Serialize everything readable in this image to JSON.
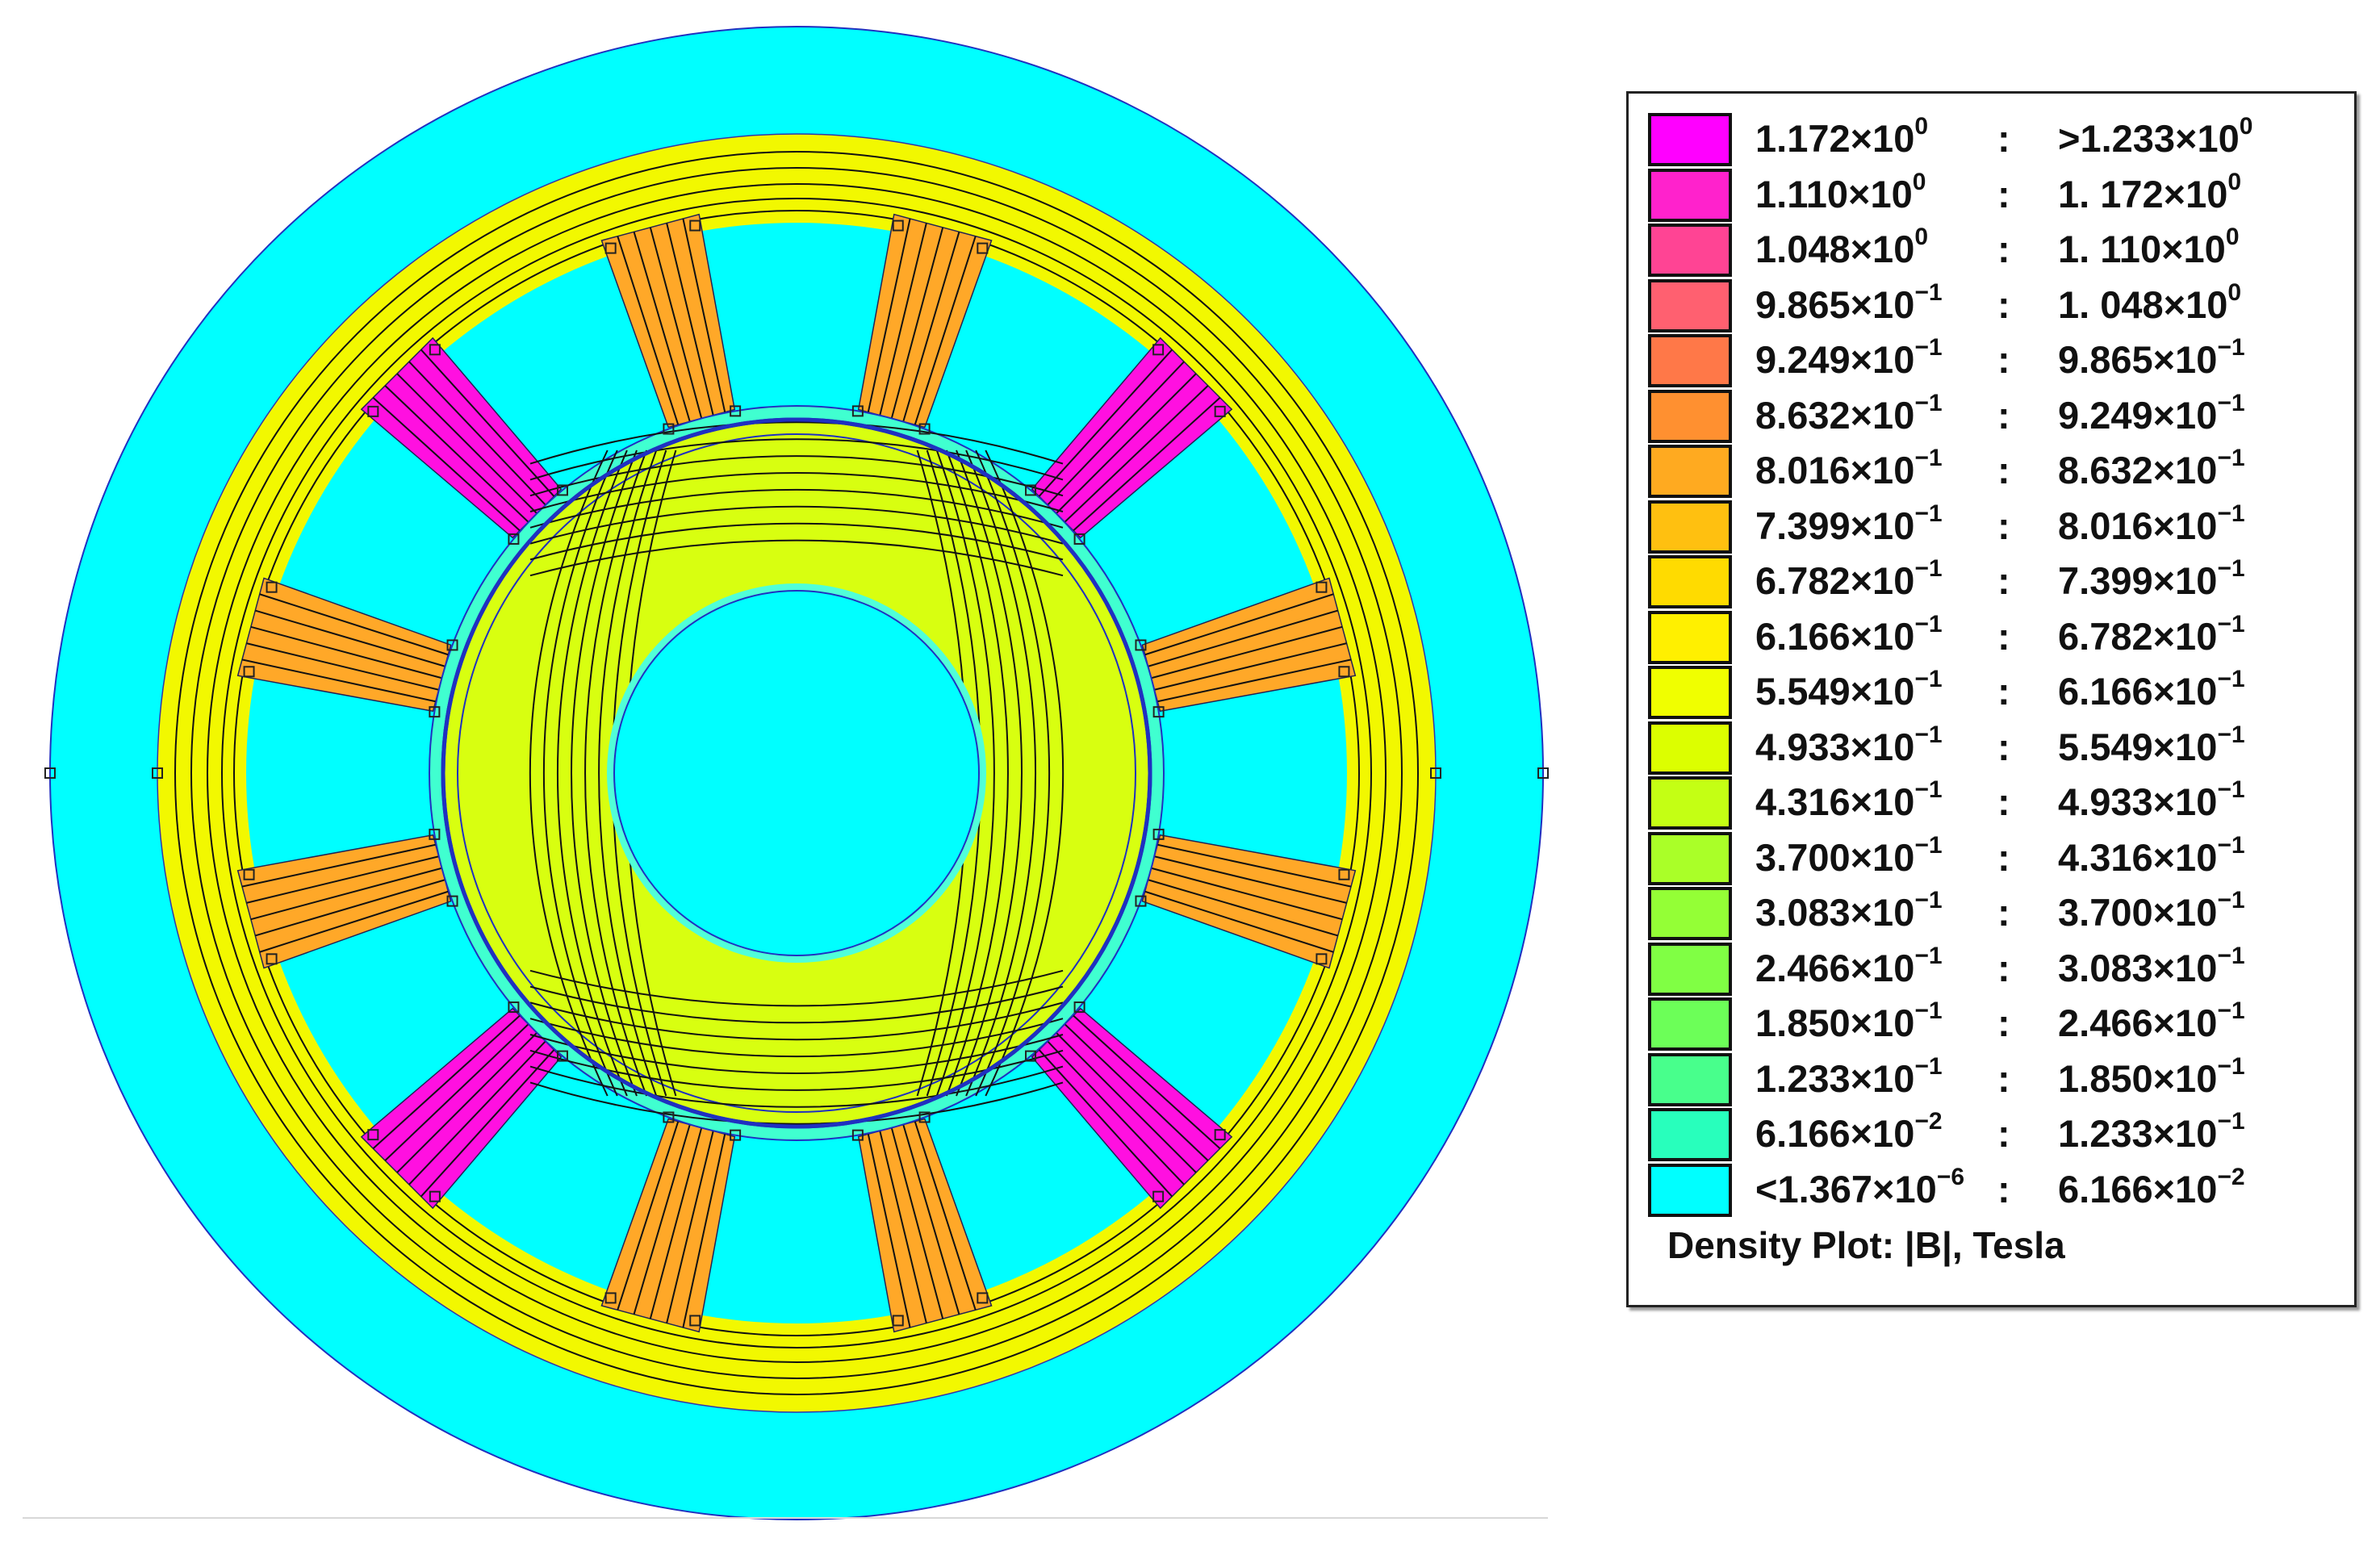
{
  "legend": {
    "title": "Density Plot: |B|, Tesla",
    "rows": [
      {
        "low": "1.172×10",
        "low_exp": "0",
        "high": ">1.233×10",
        "high_exp": "0",
        "color": "#ff00ff"
      },
      {
        "low": "1.110×10",
        "low_exp": "0",
        "high": "1. 172×10",
        "high_exp": "0",
        "color": "#ff22cc"
      },
      {
        "low": "1.048×10",
        "low_exp": "0",
        "high": "1. 110×10",
        "high_exp": "0",
        "color": "#ff4494"
      },
      {
        "low": "9.865×10",
        "low_exp": "−1",
        "high": "1. 048×10",
        "high_exp": "0",
        "color": "#ff6070"
      },
      {
        "low": "9.249×10",
        "low_exp": "−1",
        "high": "9.865×10",
        "high_exp": "−1",
        "color": "#ff7848"
      },
      {
        "low": "8.632×10",
        "low_exp": "−1",
        "high": "9.249×10",
        "high_exp": "−1",
        "color": "#ff9030"
      },
      {
        "low": "8.016×10",
        "low_exp": "−1",
        "high": "8.632×10",
        "high_exp": "−1",
        "color": "#ffaa20"
      },
      {
        "low": "7.399×10",
        "low_exp": "−1",
        "high": "8.016×10",
        "high_exp": "−1",
        "color": "#ffc010"
      },
      {
        "low": "6.782×10",
        "low_exp": "−1",
        "high": "7.399×10",
        "high_exp": "−1",
        "color": "#ffdb00"
      },
      {
        "low": "6.166×10",
        "low_exp": "−1",
        "high": "6.782×10",
        "high_exp": "−1",
        "color": "#fff000"
      },
      {
        "low": "5.549×10",
        "low_exp": "−1",
        "high": "6.166×10",
        "high_exp": "−1",
        "color": "#f0ff00"
      },
      {
        "low": "4.933×10",
        "low_exp": "−1",
        "high": "5.549×10",
        "high_exp": "−1",
        "color": "#dcff00"
      },
      {
        "low": "4.316×10",
        "low_exp": "−1",
        "high": "4.933×10",
        "high_exp": "−1",
        "color": "#c4ff14"
      },
      {
        "low": "3.700×10",
        "low_exp": "−1",
        "high": "4.316×10",
        "high_exp": "−1",
        "color": "#aaff28"
      },
      {
        "low": "3.083×10",
        "low_exp": "−1",
        "high": "3.700×10",
        "high_exp": "−1",
        "color": "#94ff36"
      },
      {
        "low": "2.466×10",
        "low_exp": "−1",
        "high": "3.083×10",
        "high_exp": "−1",
        "color": "#80ff44"
      },
      {
        "low": "1.850×10",
        "low_exp": "−1",
        "high": "2.466×10",
        "high_exp": "−1",
        "color": "#6cff58"
      },
      {
        "low": "1.233×10",
        "low_exp": "−1",
        "high": "1.850×10",
        "high_exp": "−1",
        "color": "#48ff8c"
      },
      {
        "low": "6.166×10",
        "low_exp": "−2",
        "high": "1.233×10",
        "high_exp": "−1",
        "color": "#28ffbc"
      },
      {
        "low": "<1.367×10",
        "low_exp": "−6",
        "high": "6.166×10",
        "high_exp": "−2",
        "color": "#00ffff"
      }
    ],
    "separator": ":"
  },
  "colors": {
    "air": "#00ffff",
    "yoke": "#f2f800",
    "pole": "#ffa828",
    "pole_high": "#ff10e0",
    "rotor": "#d8ff10",
    "outline": "#2030c0",
    "contour": "#111111"
  }
}
